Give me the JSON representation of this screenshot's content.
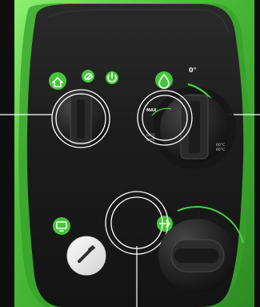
{
  "scene": {
    "colors": {
      "housing": "#56c63a",
      "housing_highlight": "#8df170",
      "housing_shadow": "#2f8a23",
      "panel": "#1f1f1f",
      "panel_dark": "#151515",
      "knob": "#252525",
      "knob_edge": "#3b3b3b",
      "callout": "#ffffff",
      "green_button": "#45c63a",
      "green_arc": "#46d040"
    },
    "icons": {
      "top_left": "home-icon",
      "top_small_1": "leaf-icon",
      "top_small_2": "power-icon",
      "center_right": "water-drop-icon",
      "bottom_left": "display-icon",
      "bottom_center": "pressure-icon"
    },
    "labels": {
      "temperature_mark": "0°",
      "max_mark": "MAX",
      "scale_1": "60°C",
      "scale_2": "80°C",
      "scale_3": "60°C",
      "scale_4": "80°C"
    }
  }
}
